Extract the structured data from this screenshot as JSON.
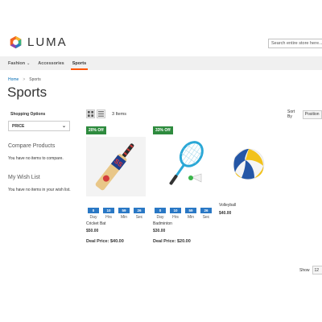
{
  "header": {
    "logo_text": "LUMA",
    "search_placeholder": "Search entire store here..."
  },
  "nav": {
    "items": [
      {
        "label": "Fashion",
        "has_dropdown": true
      },
      {
        "label": "Accessories",
        "has_dropdown": false
      },
      {
        "label": "Sports",
        "has_dropdown": false,
        "active": true
      }
    ]
  },
  "breadcrumb": {
    "home": "Home",
    "separator": ">",
    "current": "Sports"
  },
  "page_title": "Sports",
  "sidebar": {
    "filter_title": "Shopping Options",
    "filter_option": "PRICE",
    "compare_title": "Compare Products",
    "compare_text": "You have no items to compare.",
    "wishlist_title": "My Wish List",
    "wishlist_text": "You have no items in your wish list."
  },
  "toolbar": {
    "item_count": "3 Items",
    "sort_label": "Sort By",
    "sort_value": "Position",
    "show_label": "Show",
    "show_value": "12"
  },
  "countdown_labels": [
    "Day",
    "Hrs",
    "Min",
    "Sec"
  ],
  "products": [
    {
      "name": "Cricket Bat",
      "price": "$50.00",
      "badge": "20% Off",
      "deal": "Deal Price: $40.00",
      "countdown": [
        "0",
        "10",
        "59",
        "26"
      ]
    },
    {
      "name": "Badminton",
      "price": "$30.00",
      "badge": "33% Off",
      "deal": "Deal Price: $20.00",
      "countdown": [
        "0",
        "10",
        "59",
        "26"
      ]
    },
    {
      "name": "Volleyball",
      "price": "$40.00"
    }
  ],
  "colors": {
    "accent": "#ff5501",
    "badge": "#2e8b3e",
    "countdown": "#2a78c5",
    "link": "#006bb4"
  }
}
